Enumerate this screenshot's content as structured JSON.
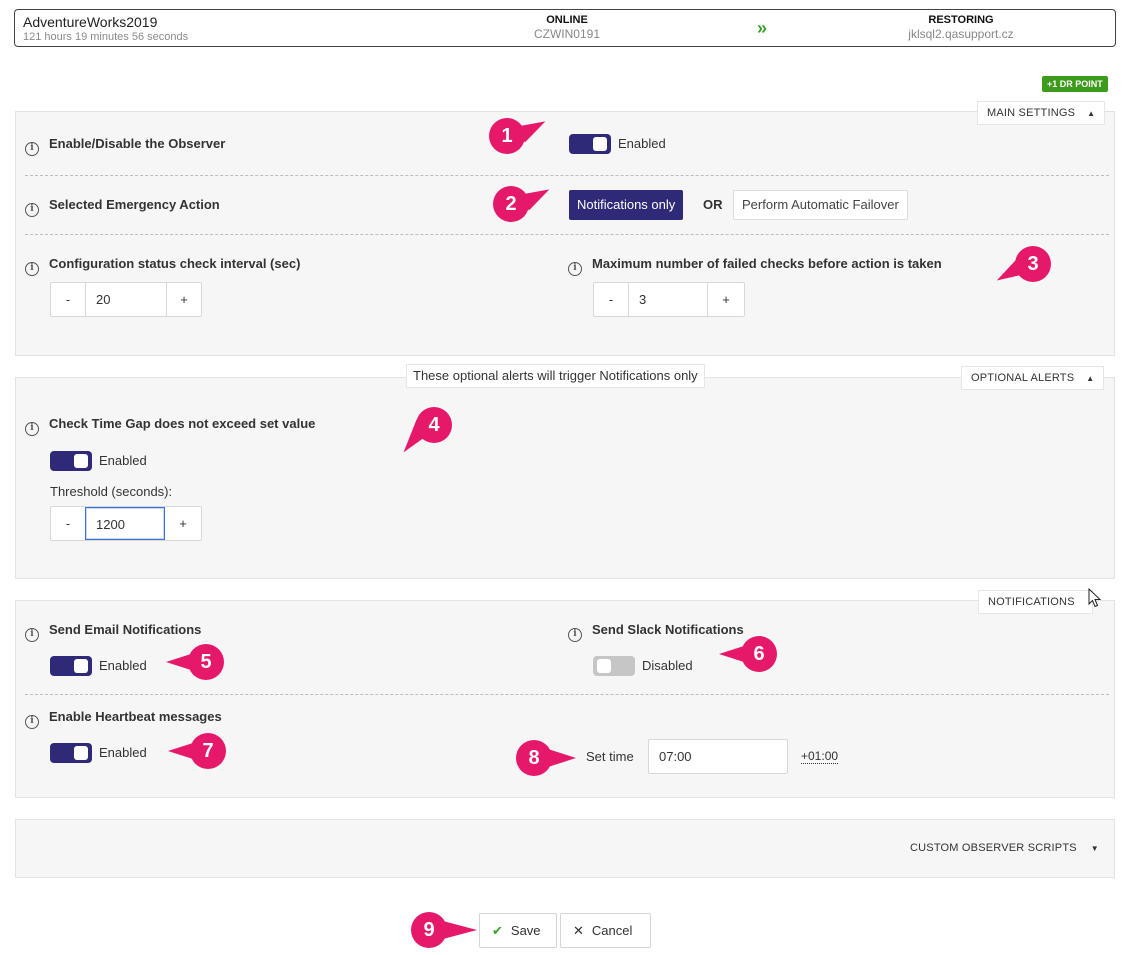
{
  "header": {
    "db_name": "AdventureWorks2019",
    "db_time": "121 hours 19 minutes 56 seconds",
    "primary_status": "ONLINE",
    "primary_server": "CZWIN0191",
    "secondary_status": "RESTORING",
    "secondary_server": "jklsql2.qasupport.cz",
    "arrow_icon": "double-chevron-right-icon"
  },
  "dr_point_badge": "+1 DR POINT",
  "main_settings": {
    "tab_label": "MAIN SETTINGS",
    "observer": {
      "label": "Enable/Disable the Observer",
      "state": "Enabled"
    },
    "emergency": {
      "label": "Selected Emergency Action",
      "option_selected": "Notifications only",
      "or_text": "OR",
      "option_other": "Perform Automatic Failover"
    },
    "interval": {
      "label": "Configuration status check interval (sec)",
      "minus": "-",
      "value": "20",
      "plus": "+"
    },
    "failed_checks": {
      "label": "Maximum number of failed checks before action is taken",
      "minus": "-",
      "value": "3",
      "plus": "+"
    }
  },
  "optional_alerts": {
    "tab_label": "OPTIONAL ALERTS",
    "note": "These optional alerts will trigger Notifications only",
    "time_gap": {
      "label": "Check Time Gap does not exceed set value",
      "state": "Enabled",
      "threshold_label": "Threshold (seconds):",
      "minus": "-",
      "value": "1200",
      "plus": "+"
    }
  },
  "notifications": {
    "tab_label": "NOTIFICATIONS",
    "email": {
      "label": "Send Email Notifications",
      "state": "Enabled"
    },
    "slack": {
      "label": "Send Slack Notifications",
      "state": "Disabled"
    },
    "heartbeat": {
      "label": "Enable Heartbeat messages",
      "state": "Enabled"
    },
    "set_time": {
      "label": "Set time",
      "value": "07:00",
      "timezone": "+01:00"
    }
  },
  "custom_scripts": {
    "tab_label": "CUSTOM OBSERVER SCRIPTS"
  },
  "footer": {
    "save": "Save",
    "cancel": "Cancel"
  },
  "markers": [
    "1",
    "2",
    "3",
    "4",
    "5",
    "6",
    "7",
    "8",
    "9"
  ],
  "colors": {
    "accent": "#2e2a78",
    "marker": "#e6186a",
    "success": "#3aa12a",
    "disabled": "#c6c6c6"
  }
}
